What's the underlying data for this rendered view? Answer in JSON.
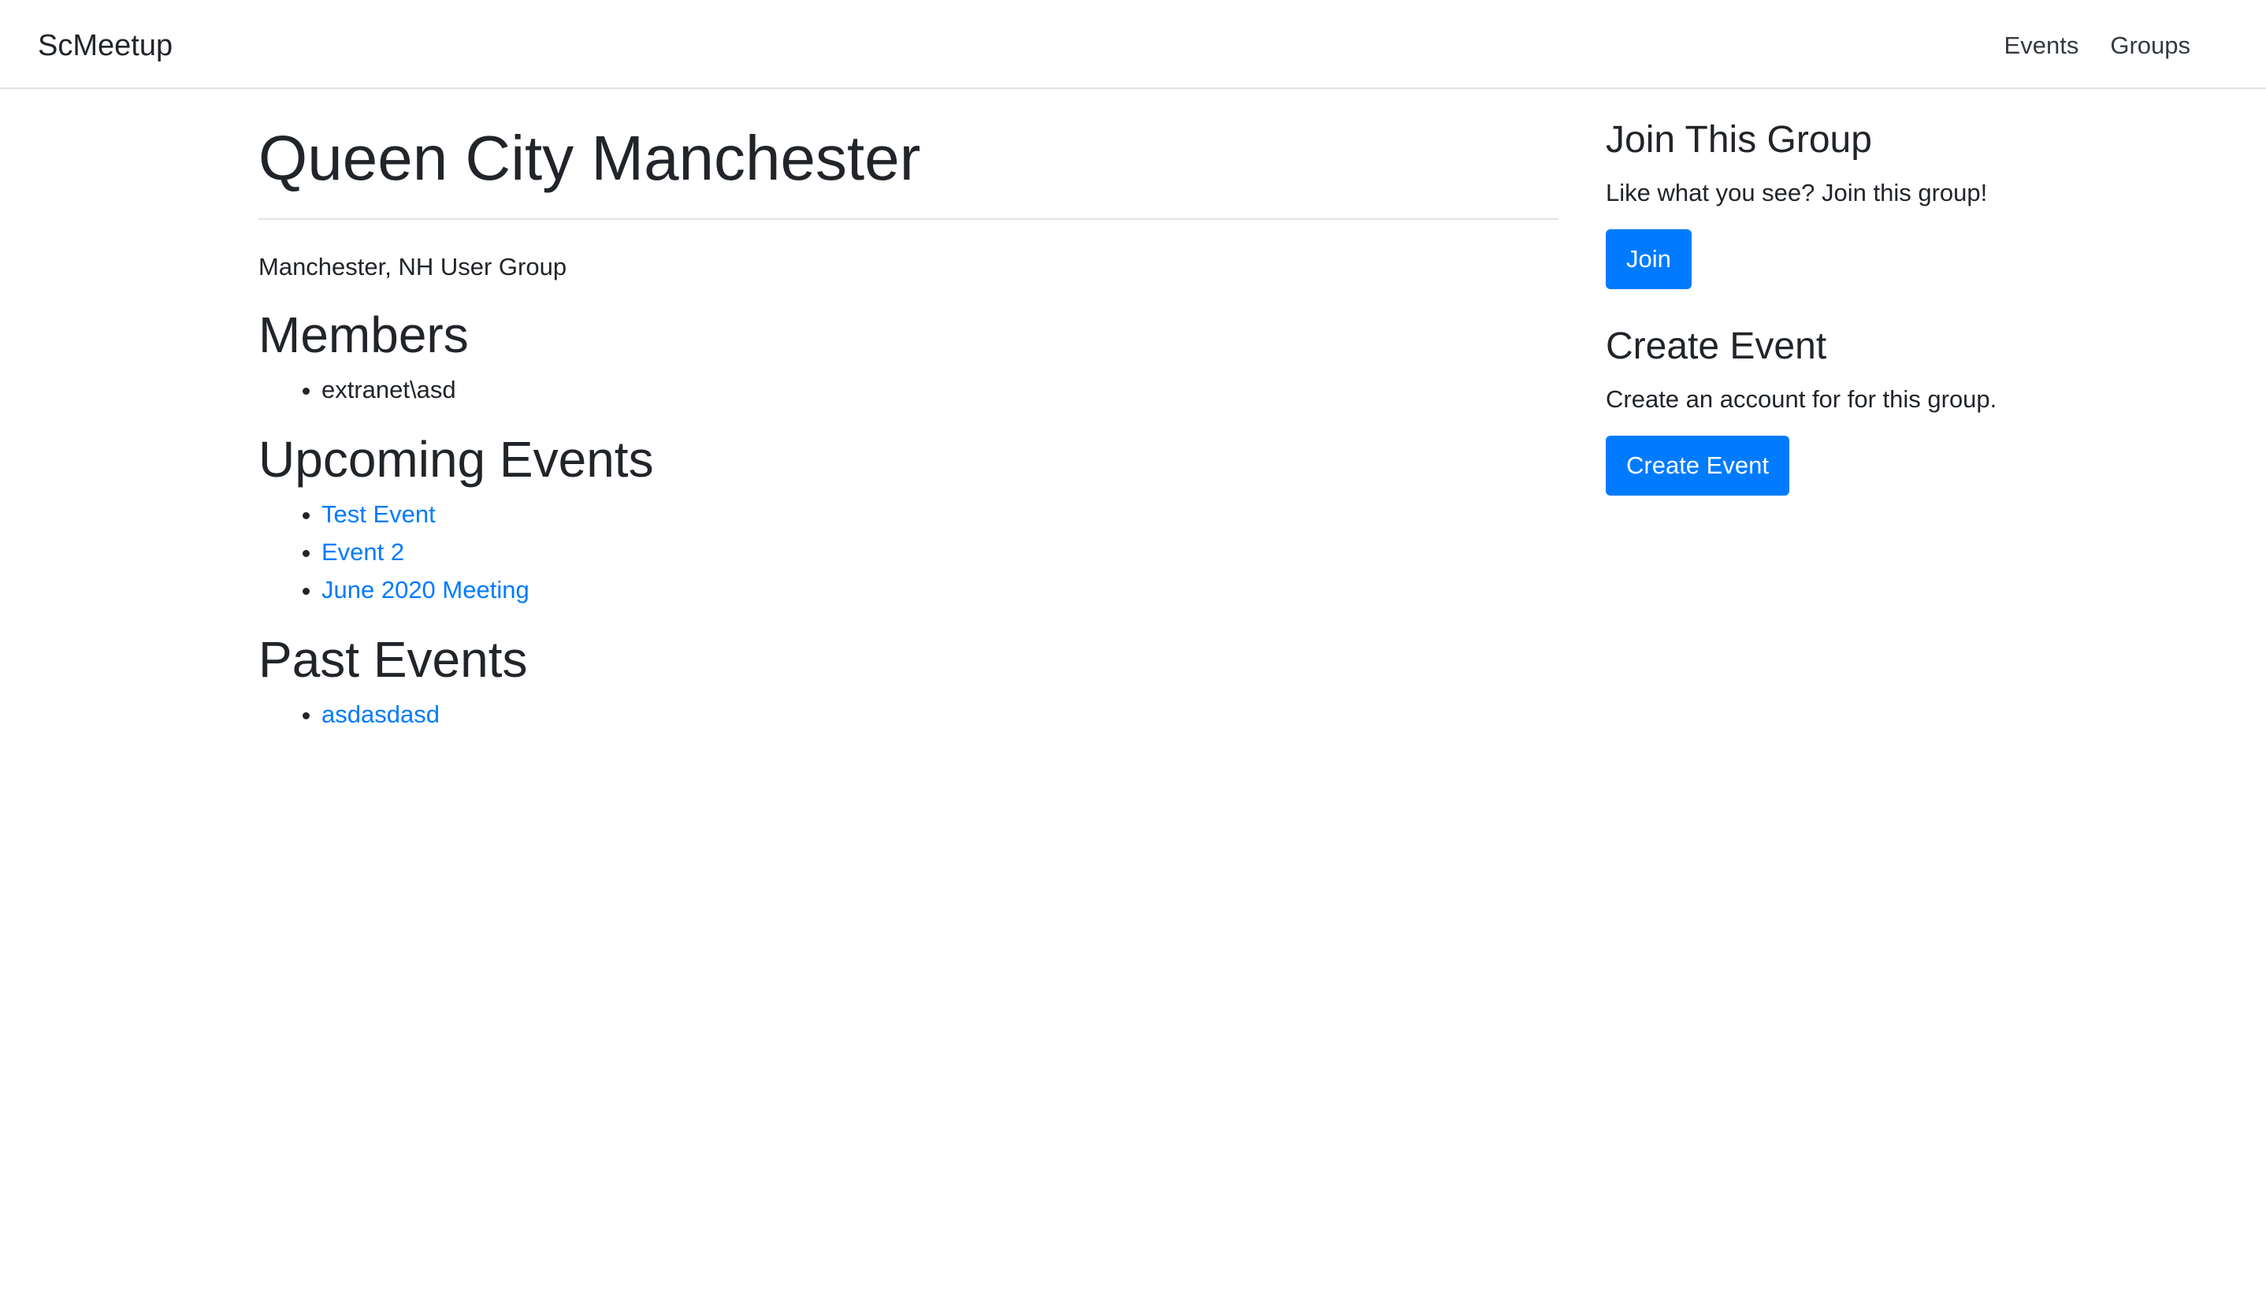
{
  "navbar": {
    "brand": "ScMeetup",
    "links": [
      "Events",
      "Groups"
    ]
  },
  "group": {
    "title": "Queen City Manchester",
    "description": "Manchester, NH User Group"
  },
  "members": {
    "heading": "Members",
    "items": [
      "extranet\\asd"
    ]
  },
  "upcoming": {
    "heading": "Upcoming Events",
    "items": [
      "Test Event",
      "Event 2",
      "June 2020 Meeting"
    ]
  },
  "past": {
    "heading": "Past Events",
    "items": [
      "asdasdasd"
    ]
  },
  "sidebar": {
    "join_heading": "Join This Group",
    "join_text": "Like what you see? Join this group!",
    "join_button": "Join",
    "create_heading": "Create Event",
    "create_text": "Create an account for for this group.",
    "create_button": "Create Event"
  },
  "colors": {
    "link": "#007bff",
    "button": "#007bff",
    "text": "#212529"
  }
}
